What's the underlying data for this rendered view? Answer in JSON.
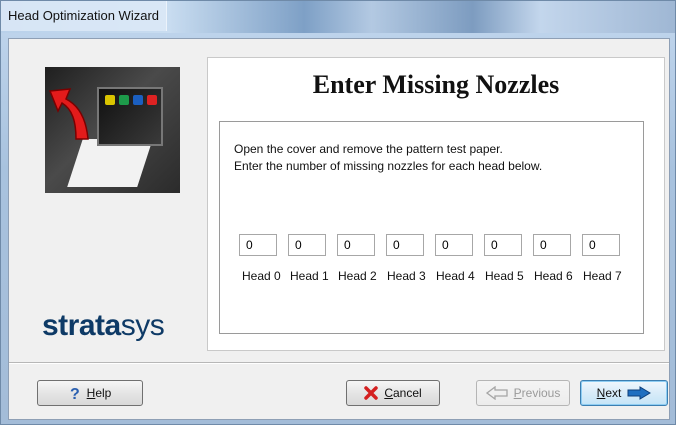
{
  "window": {
    "title": "Head Optimization Wizard"
  },
  "logo": {
    "bold": "strata",
    "light": "sys"
  },
  "page": {
    "heading": "Enter Missing Nozzles",
    "instructions": [
      "Open the cover and remove the pattern test paper.",
      "Enter the number of missing nozzles for each head below."
    ]
  },
  "heads": [
    {
      "label": "Head 0",
      "value": "0"
    },
    {
      "label": "Head 1",
      "value": "0"
    },
    {
      "label": "Head 2",
      "value": "0"
    },
    {
      "label": "Head 3",
      "value": "0"
    },
    {
      "label": "Head 4",
      "value": "0"
    },
    {
      "label": "Head 5",
      "value": "0"
    },
    {
      "label": "Head 6",
      "value": "0"
    },
    {
      "label": "Head 7",
      "value": "0"
    }
  ],
  "buttons": {
    "help": {
      "accel": "H",
      "rest": "elp",
      "icon": "question-mark-icon"
    },
    "cancel": {
      "accel": "C",
      "rest": "ancel",
      "icon": "red-x-icon"
    },
    "previous": {
      "accel": "P",
      "rest": "revious",
      "icon": "back-arrow-icon"
    },
    "next": {
      "accel": "N",
      "rest": "ext",
      "icon": "forward-arrow-icon"
    }
  },
  "colors": {
    "logo": "#0e3a66",
    "cancel_icon": "#d42020",
    "next_arrow": "#1f6fc0"
  }
}
